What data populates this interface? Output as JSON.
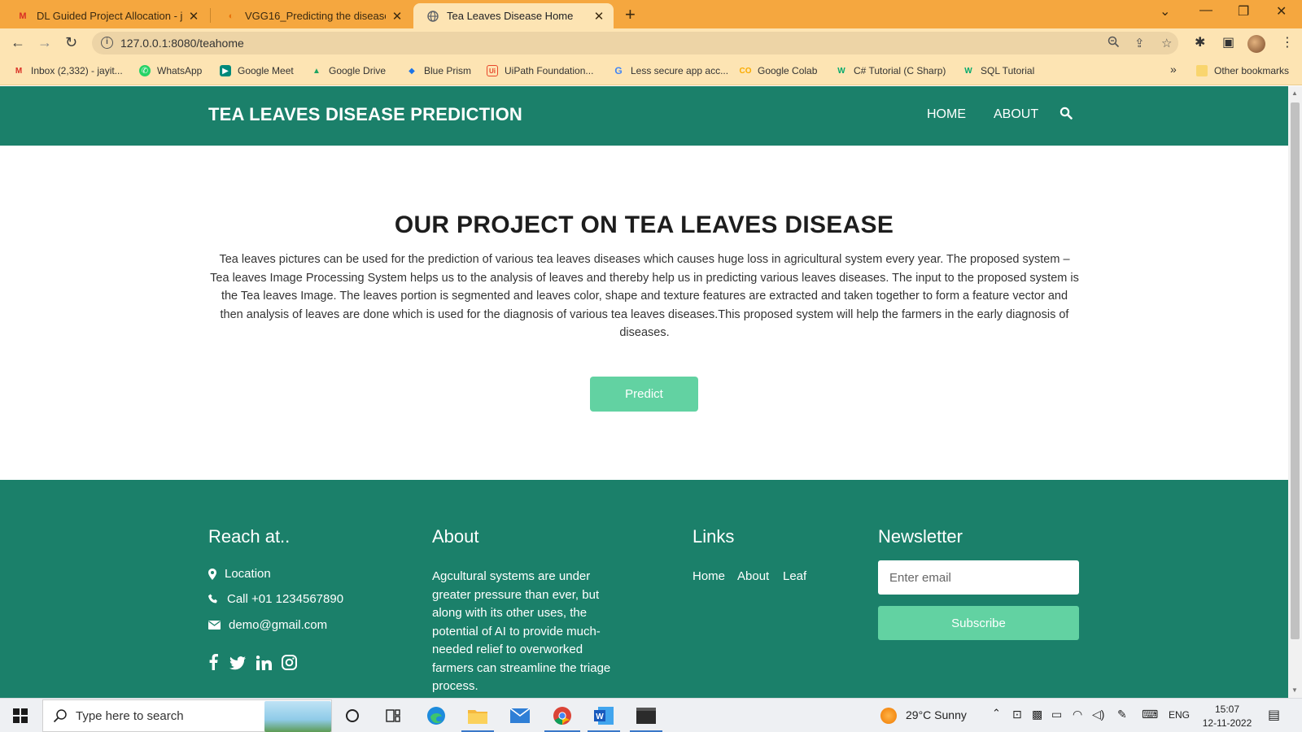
{
  "browser": {
    "tabs": [
      {
        "title": "DL Guided Project Allocation - ja",
        "icon": "gmail-icon"
      },
      {
        "title": "VGG16_Predicting the disease in",
        "icon": "colab-icon"
      },
      {
        "title": "Tea Leaves Disease Home",
        "icon": "globe-icon",
        "active": true
      }
    ],
    "url": "127.0.0.1:8080/teahome",
    "bookmarks": [
      {
        "label": "Inbox (2,332) - jayit...",
        "icon": "gmail-icon"
      },
      {
        "label": "WhatsApp",
        "icon": "whatsapp-icon"
      },
      {
        "label": "Google Meet",
        "icon": "meet-icon"
      },
      {
        "label": "Google Drive",
        "icon": "drive-icon"
      },
      {
        "label": "Blue Prism",
        "icon": "blueprism-icon"
      },
      {
        "label": "UiPath Foundation...",
        "icon": "uipath-icon"
      },
      {
        "label": "Less secure app acc...",
        "icon": "google-icon"
      },
      {
        "label": "Google Colab",
        "icon": "colab-icon"
      },
      {
        "label": "C# Tutorial (C Sharp)",
        "icon": "w3-icon"
      },
      {
        "label": "SQL Tutorial",
        "icon": "w3-icon"
      }
    ],
    "more_bookmarks": "»",
    "other_bookmarks": "Other bookmarks"
  },
  "site": {
    "brand": "TEA LEAVES DISEASE PREDICTION",
    "nav": {
      "home": "HOME",
      "about": "ABOUT"
    },
    "hero": {
      "title": "OUR PROJECT ON TEA LEAVES DISEASE",
      "text": "Tea leaves pictures can be used for the prediction of various tea leaves diseases which causes huge loss in agricultural system every year. The proposed system – Tea leaves Image Processing System helps us to the analysis of leaves and thereby help us in predicting various leaves diseases. The input to the proposed system is the Tea leaves Image. The leaves portion is segmented and leaves color, shape and texture features are extracted and taken together to form a feature vector and then analysis of leaves are done which is used for the diagnosis of various tea leaves diseases.This proposed system will help the farmers in the early diagnosis of diseases.",
      "predict_label": "Predict"
    },
    "footer": {
      "reach_title": "Reach at..",
      "location": "Location",
      "call": "Call +01 1234567890",
      "email": "demo@gmail.com",
      "about_title": "About",
      "about_text": "Agcultural systems are under greater pressure than ever, but along with its other uses, the potential of AI to provide much-needed relief to overworked farmers can streamline the triage process.",
      "links_title": "Links",
      "links": {
        "home": "Home",
        "about": "About",
        "leaf": "Leaf"
      },
      "newsletter_title": "Newsletter",
      "email_placeholder": "Enter email",
      "subscribe_label": "Subscribe"
    },
    "colors": {
      "primary": "#1b806a",
      "accent": "#62d2a2"
    }
  },
  "taskbar": {
    "search_placeholder": "Type here to search",
    "weather": "29°C  Sunny",
    "language": "ENG",
    "time": "15:07",
    "date": "12-11-2022"
  }
}
